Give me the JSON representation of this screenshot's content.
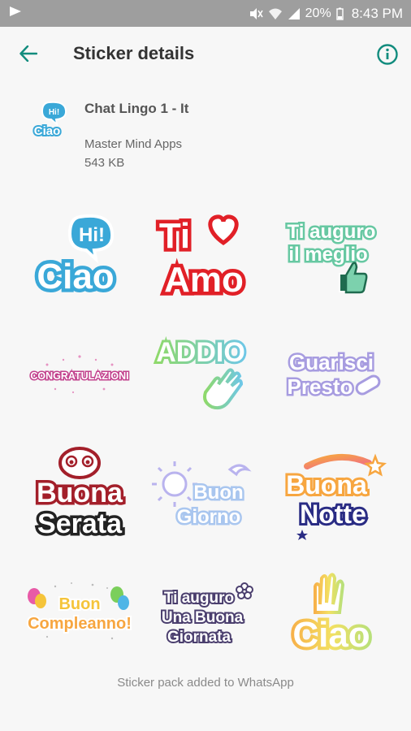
{
  "status_bar": {
    "battery": "20%",
    "time": "8:43 PM"
  },
  "toolbar": {
    "title": "Sticker details",
    "back_icon": "arrow-left-icon",
    "info_icon": "info-icon"
  },
  "pack": {
    "name": "Chat Lingo 1 - It",
    "publisher": "Master Mind Apps",
    "size": "543 KB",
    "icon_text_top": "Hi!",
    "icon_text_bottom": "Ciao"
  },
  "stickers": [
    {
      "lines": [
        "Hi!",
        "Ciao"
      ]
    },
    {
      "lines": [
        "Ti",
        "Amo"
      ]
    },
    {
      "lines": [
        "Ti auguro",
        "il meglio"
      ]
    },
    {
      "lines": [
        "CONGRATULAZIONI"
      ]
    },
    {
      "lines": [
        "ADDIO"
      ]
    },
    {
      "lines": [
        "Guarisci",
        "Presto"
      ]
    },
    {
      "lines": [
        "Buona",
        "Serata"
      ]
    },
    {
      "lines": [
        "Buon",
        "Giorno"
      ]
    },
    {
      "lines": [
        "Buona",
        "Notte"
      ]
    },
    {
      "lines": [
        "Buon",
        "Compleanno!"
      ]
    },
    {
      "lines": [
        "Ti auguro",
        "Una Buona",
        "Giornata"
      ]
    },
    {
      "lines": [
        "Ciao"
      ]
    }
  ],
  "footer": {
    "text": "Sticker pack added to WhatsApp"
  },
  "colors": {
    "accent": "#128c7e",
    "status_bar": "#9e9e9e",
    "background": "#f7f7f7"
  }
}
